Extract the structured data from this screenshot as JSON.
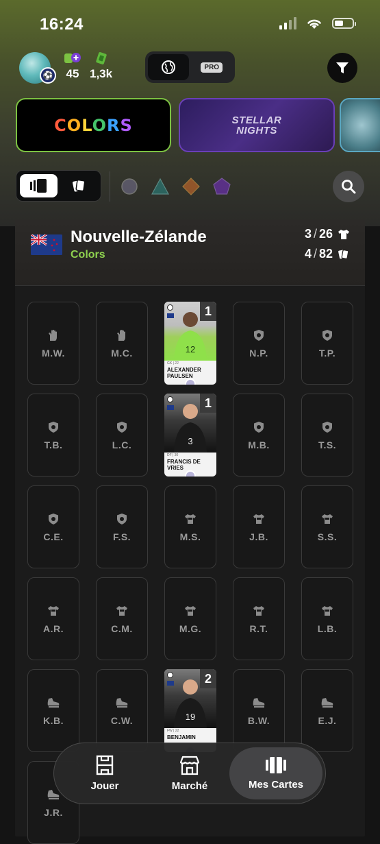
{
  "status_bar": {
    "time": "16:24"
  },
  "header": {
    "stat_xp": "45",
    "stat_coins": "1,3k",
    "mode_pro_label": "PRO"
  },
  "collections": {
    "colors_label": "COLORS",
    "stellar_line1": "STELLAR",
    "stellar_line2": "NIGHTS"
  },
  "team": {
    "name": "Nouvelle-Zélande",
    "collection": "Colors",
    "shirts_owned": "3",
    "shirts_total": "26",
    "cards_owned": "4",
    "cards_total": "82"
  },
  "slots": [
    {
      "label": "M.W.",
      "icon": "glove-icon",
      "type": "empty"
    },
    {
      "label": "M.C.",
      "icon": "glove-icon",
      "type": "empty"
    },
    {
      "type": "card",
      "name": "Alexander Paulsen",
      "count": "1",
      "meta": "GK | 22",
      "jersey": "12",
      "color": "#8fe04a"
    },
    {
      "label": "N.P.",
      "icon": "shield-icon",
      "type": "empty"
    },
    {
      "label": "T.P.",
      "icon": "shield-icon",
      "type": "empty"
    },
    {
      "label": "T.B.",
      "icon": "shield-icon",
      "type": "empty"
    },
    {
      "label": "L.C.",
      "icon": "shield-icon",
      "type": "empty"
    },
    {
      "type": "card",
      "name": "Francis de Vries",
      "count": "1",
      "meta": "DF | 30",
      "jersey": "3",
      "color": "#1a1a1a"
    },
    {
      "label": "M.B.",
      "icon": "shield-icon",
      "type": "empty"
    },
    {
      "label": "T.S.",
      "icon": "shield-icon",
      "type": "empty"
    },
    {
      "label": "C.E.",
      "icon": "shield-icon",
      "type": "empty"
    },
    {
      "label": "F.S.",
      "icon": "shield-icon",
      "type": "empty"
    },
    {
      "label": "M.S.",
      "icon": "jersey-icon",
      "type": "empty"
    },
    {
      "label": "J.B.",
      "icon": "jersey-icon",
      "type": "empty"
    },
    {
      "label": "S.S.",
      "icon": "jersey-icon",
      "type": "empty"
    },
    {
      "label": "A.R.",
      "icon": "jersey-icon",
      "type": "empty"
    },
    {
      "label": "C.M.",
      "icon": "jersey-icon",
      "type": "empty"
    },
    {
      "label": "M.G.",
      "icon": "jersey-icon",
      "type": "empty"
    },
    {
      "label": "R.T.",
      "icon": "jersey-icon",
      "type": "empty"
    },
    {
      "label": "L.B.",
      "icon": "jersey-icon",
      "type": "empty"
    },
    {
      "label": "K.B.",
      "icon": "boot-icon",
      "type": "empty"
    },
    {
      "label": "C.W.",
      "icon": "boot-icon",
      "type": "empty"
    },
    {
      "type": "card",
      "name": "Benjamin",
      "count": "2",
      "meta": "FW | 22",
      "jersey": "19",
      "color": "#1a1a1a"
    },
    {
      "label": "B.W.",
      "icon": "boot-icon",
      "type": "empty"
    },
    {
      "label": "E.J.",
      "icon": "boot-icon",
      "type": "empty"
    },
    {
      "label": "J.R.",
      "icon": "boot-icon",
      "type": "empty"
    }
  ],
  "nav": {
    "play": "Jouer",
    "market": "Marché",
    "my_cards": "Mes Cartes"
  },
  "colors": {
    "accent_green": "#8fd14f",
    "colors_border": "#7cc242",
    "stellar_border": "#6a3fb8"
  }
}
